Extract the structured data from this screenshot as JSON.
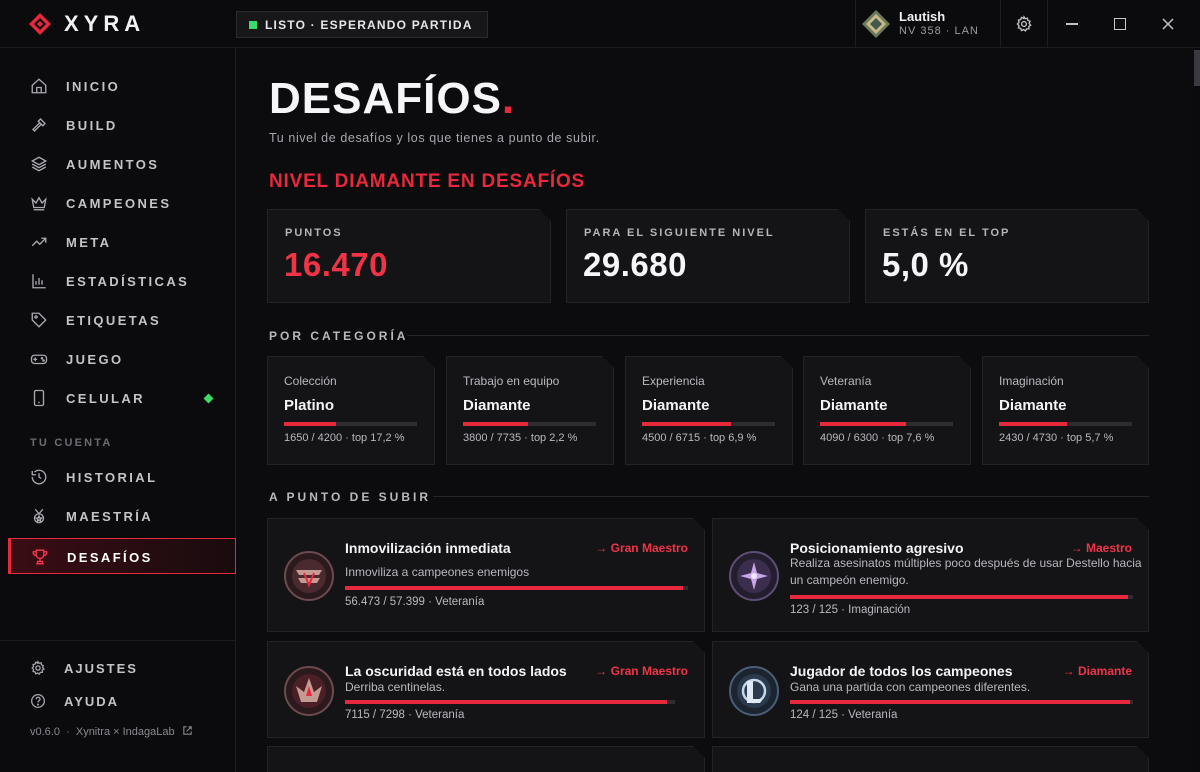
{
  "app": {
    "brand": "XYRA",
    "status": "LISTO · ESPERANDO PARTIDA"
  },
  "profile": {
    "name": "Lautish",
    "meta": "NV 358  ·  LAN"
  },
  "sidebar": {
    "items": [
      {
        "label": "INICIO",
        "icon": "home-icon"
      },
      {
        "label": "BUILD",
        "icon": "hammer-icon"
      },
      {
        "label": "AUMENTOS",
        "icon": "layers-icon"
      },
      {
        "label": "CAMPEONES",
        "icon": "crown-icon"
      },
      {
        "label": "META",
        "icon": "trending-icon"
      },
      {
        "label": "ESTADÍSTICAS",
        "icon": "bar-chart-icon"
      },
      {
        "label": "ETIQUETAS",
        "icon": "tag-icon"
      },
      {
        "label": "JUEGO",
        "icon": "gamepad-icon"
      },
      {
        "label": "CELULAR",
        "icon": "phone-icon"
      }
    ],
    "account_label": "TU CUENTA",
    "account_items": [
      {
        "label": "HISTORIAL",
        "icon": "history-icon"
      },
      {
        "label": "MAESTRÍA",
        "icon": "medal-icon"
      },
      {
        "label": "DESAFÍOS",
        "icon": "trophy-icon"
      }
    ],
    "bottom": {
      "settings": "AJUSTES",
      "help": "AYUDA"
    },
    "version": "v0.6.0  ·  Xynitra × IndagaLab"
  },
  "page": {
    "title": "DESAFÍOS",
    "title_dot": ".",
    "subtitle": "Tu nivel de desafíos y los que tienes a punto de subir.",
    "rank_heading": "NIVEL DIAMANTE EN DESAFÍOS"
  },
  "stats": {
    "points_label": "PUNTOS",
    "points_value": "16.470",
    "next_label": "PARA EL SIGUIENTE NIVEL",
    "next_value": "29.680",
    "top_label": "ESTÁS EN EL TOP",
    "top_value": "5,0 %"
  },
  "categories_heading": "POR CATEGORÍA",
  "categories": [
    {
      "name": "Colección",
      "tier": "Platino",
      "progress": "1650 / 4200 · top 17,2 %",
      "fraction": 0.393
    },
    {
      "name": "Trabajo en equipo",
      "tier": "Diamante",
      "progress": "3800 / 7735 · top 2,2 %",
      "fraction": 0.491
    },
    {
      "name": "Experiencia",
      "tier": "Diamante",
      "progress": "4500 / 6715 · top 6,9 %",
      "fraction": 0.67
    },
    {
      "name": "Veteranía",
      "tier": "Diamante",
      "progress": "4090 / 6300 · top 7,6 %",
      "fraction": 0.649
    },
    {
      "name": "Imaginación",
      "tier": "Diamante",
      "progress": "2430 / 4730 · top 5,7 %",
      "fraction": 0.514
    }
  ],
  "near_heading": "A PUNTO DE SUBIR",
  "challenges": [
    {
      "title": "Inmovilización inmediata",
      "target": "→ Gran Maestro",
      "desc": "Inmoviliza a campeones enemigos",
      "progress": "56.473 / 57.399 · Veteranía",
      "fraction": 0.984
    },
    {
      "title": "Posicionamiento agresivo",
      "target": "→ Maestro",
      "desc": "Realiza asesinatos múltiples poco después de usar Destello hacia un campeón enemigo.",
      "progress": "123 / 125 · Imaginación",
      "fraction": 0.984
    },
    {
      "title": "La oscuridad está en todos lados",
      "target": "→ Gran Maestro",
      "desc": "Derriba centinelas.",
      "progress": "7115 / 7298 · Veteranía",
      "fraction": 0.975
    },
    {
      "title": "Jugador de todos los campeones",
      "target": "→ Diamante",
      "desc": "Gana una partida con campeones diferentes.",
      "progress": "124 / 125 · Veteranía",
      "fraction": 0.992
    }
  ],
  "colors": {
    "accent": "#e8283c",
    "online": "#3ddc6a",
    "background": "#0c0c0e",
    "card": "#141417"
  }
}
